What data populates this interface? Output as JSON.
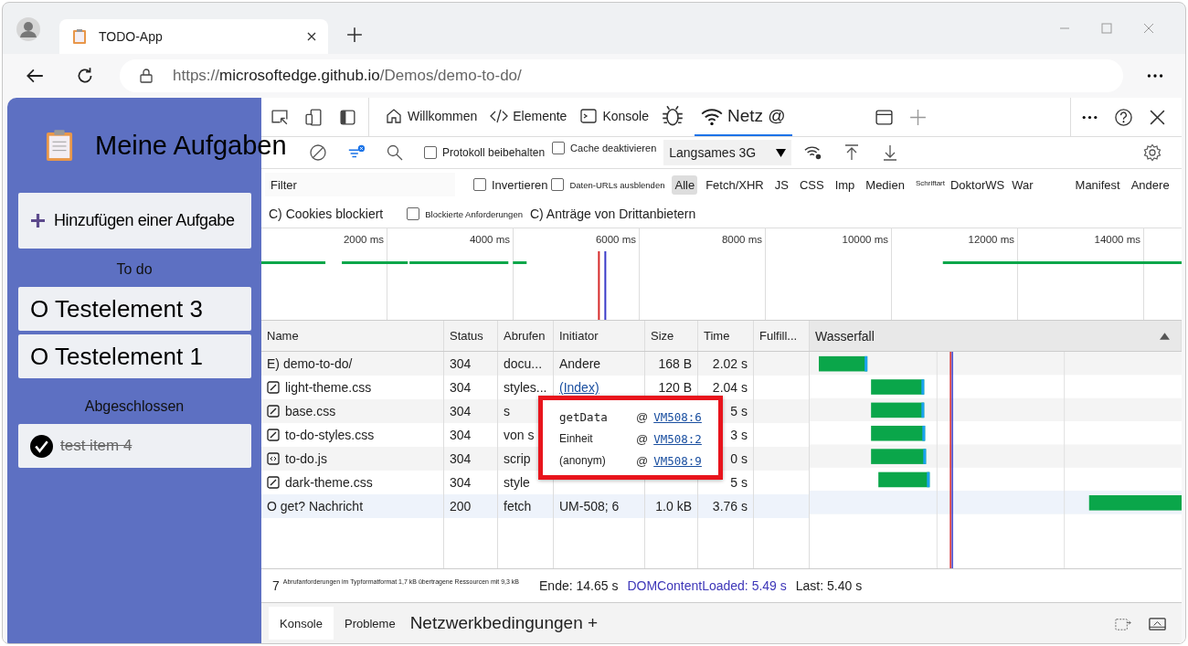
{
  "browser": {
    "tab_title": "TODO-App",
    "url_prefix": "https://",
    "url_host": "microsoftedge.github.io",
    "url_path": "/Demos/demo-to-do/"
  },
  "app": {
    "title": "Meine Aufgaben",
    "add_button": "Hinzufügen einer Aufgabe",
    "sections": [
      {
        "heading": "To do",
        "items": [
          {
            "text": "O Testelement 3",
            "done": false
          },
          {
            "text": "O Testelement 1",
            "done": false
          }
        ]
      },
      {
        "heading": "Abgeschlossen",
        "items": [
          {
            "text": "test item 4",
            "done": true
          }
        ]
      }
    ]
  },
  "devtools": {
    "tabs": [
      {
        "label": "Willkommen",
        "kind": "home",
        "selected": false
      },
      {
        "label": "Elemente",
        "kind": "code",
        "selected": false
      },
      {
        "label": "Konsole",
        "kind": "console",
        "selected": false
      },
      {
        "kind": "bug",
        "selected": false
      },
      {
        "label": "Netz @",
        "kind": "wifi",
        "selected": true
      }
    ],
    "toolbar": {
      "checkboxes": [
        {
          "label": "Protokoll beibehalten",
          "checked": false
        },
        {
          "label": "Cache deaktivieren",
          "checked": false
        }
      ],
      "throttle": "Langsames 3G"
    },
    "filter": {
      "placeholder": "Filter",
      "checkboxes": [
        {
          "label": "Invertieren",
          "checked": false
        },
        {
          "label": "Daten-URLs ausblenden",
          "checked": false
        }
      ],
      "types": [
        {
          "label": "Alle",
          "selected": true
        },
        {
          "label": "Fetch/XHR",
          "selected": false
        },
        {
          "label": "JS",
          "selected": false
        },
        {
          "label": "CSS",
          "selected": false
        },
        {
          "label": "Imp",
          "selected": false
        },
        {
          "label": "Medien",
          "selected": false
        },
        {
          "label": "Schriftart",
          "selected": false
        },
        {
          "label": "DoktorWS",
          "selected": false
        },
        {
          "label": "War",
          "selected": false
        },
        {
          "label": "Manifest",
          "selected": false
        },
        {
          "label": "Andere",
          "selected": false
        }
      ],
      "row2": [
        {
          "kind": "text",
          "label": "C) Cookies blockiert"
        },
        {
          "kind": "checkbox",
          "label": "Blockierte Anforderungen",
          "checked": false
        },
        {
          "kind": "text",
          "label": "C) Anträge von Drittanbietern"
        }
      ]
    },
    "overview": {
      "ticks": [
        "2000 ms",
        "4000 ms",
        "6000 ms",
        "8000 ms",
        "10000 ms",
        "12000 ms",
        "14000 ms"
      ]
    },
    "table": {
      "columns": [
        "Name",
        "Status",
        "Abrufen",
        "Initiator",
        "Size",
        "Time",
        "Fulfill...",
        "Wasserfall"
      ],
      "rows": [
        {
          "kind": "doc",
          "name": "E) demo-to-do/",
          "status": "304",
          "type": "docu...",
          "initiator": "Andere",
          "size": "168 B",
          "time": "2.02 s",
          "link": false
        },
        {
          "kind": "css",
          "name": "light-theme.css",
          "status": "304",
          "type": "styles...",
          "initiator": "(Index)",
          "size": "120 B",
          "time": "2.04 s",
          "link": true
        },
        {
          "kind": "css",
          "name": "base.css",
          "status": "304",
          "type": "s",
          "time": "5 s"
        },
        {
          "kind": "css",
          "name": "to-do-styles.css",
          "status": "304",
          "type": "von s",
          "time": "3 s"
        },
        {
          "kind": "js",
          "name": "to-do.js",
          "status": "304",
          "type": "scrip",
          "time": "0 s"
        },
        {
          "kind": "css",
          "name": "dark-theme.css",
          "status": "304",
          "type": "style",
          "time": "5 s"
        },
        {
          "kind": "doc",
          "name": "O get? Nachricht",
          "status": "200",
          "type": "fetch",
          "initiator": "UM-508; 6",
          "size": "1.0 kB",
          "time": "3.76 s",
          "link": false
        }
      ]
    },
    "tooltip": {
      "frames": [
        {
          "fn": "getData",
          "mono": true,
          "at": "@",
          "link": "VM508:6"
        },
        {
          "fn": "Einheit",
          "mono": false,
          "at": "@",
          "link": "VM508:2"
        },
        {
          "fn": "(anonym)",
          "mono": false,
          "at": "@",
          "link": "VM508:9"
        }
      ]
    },
    "summary": {
      "count": "7",
      "detail": "Abrufanforderungen im Typformatformat 1,7 kB übertragene Ressourcen mit 9,3 kB",
      "finish": "Ende: 14.65 s",
      "dcl": "DOMContentLoaded: 5.49 s",
      "load": "Last: 5.40 s"
    },
    "drawer": {
      "tabs": [
        {
          "label": "Konsole",
          "selected": true
        },
        {
          "label": "Probleme",
          "selected": false
        },
        {
          "label": "Netzwerkbedingungen +",
          "selected": false
        }
      ]
    }
  }
}
